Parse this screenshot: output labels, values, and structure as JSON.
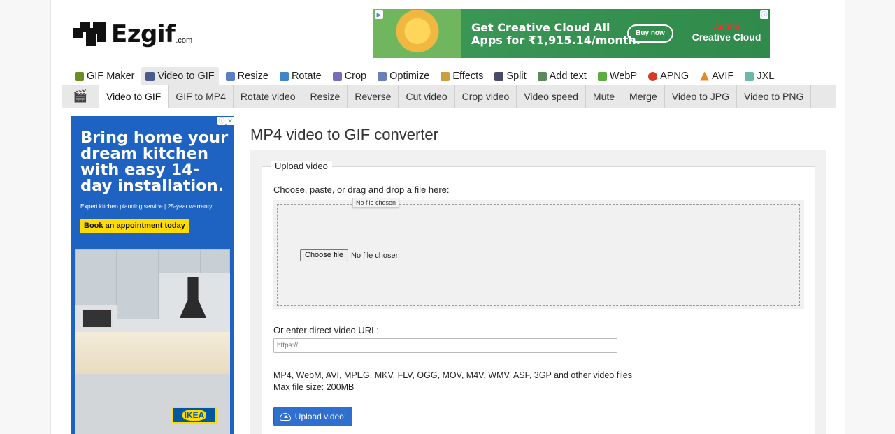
{
  "logo": {
    "name": "Ezgif",
    "suffix": ".com"
  },
  "top_ad": {
    "line1": "Get Creative Cloud All",
    "line2": "Apps for ₹1,915.14/month.",
    "button": "Buy now",
    "brand_line1": "Adobe",
    "brand_line2": "Creative Cloud"
  },
  "main_nav": [
    {
      "label": "GIF Maker",
      "icon": "gif-maker-icon",
      "color": "#6b8e23"
    },
    {
      "label": "Video to GIF",
      "icon": "video-to-gif-icon",
      "color": "#4a5a8a",
      "active": true
    },
    {
      "label": "Resize",
      "icon": "resize-icon",
      "color": "#5b7fc4"
    },
    {
      "label": "Rotate",
      "icon": "rotate-icon",
      "color": "#3f86c9"
    },
    {
      "label": "Crop",
      "icon": "crop-icon",
      "color": "#7a6ab8"
    },
    {
      "label": "Optimize",
      "icon": "optimize-icon",
      "color": "#6a7fb8"
    },
    {
      "label": "Effects",
      "icon": "effects-icon",
      "color": "#c9a03f"
    },
    {
      "label": "Split",
      "icon": "split-icon",
      "color": "#4a4a6a"
    },
    {
      "label": "Add text",
      "icon": "add-text-icon",
      "color": "#5a8a5a"
    },
    {
      "label": "WebP",
      "icon": "webp-icon",
      "color": "#5aad3f"
    },
    {
      "label": "APNG",
      "icon": "apng-icon",
      "color": "#d83a2a"
    },
    {
      "label": "AVIF",
      "icon": "avif-icon",
      "color": "#e08a2a"
    },
    {
      "label": "JXL",
      "icon": "jxl-icon",
      "color": "#6ab8a8"
    }
  ],
  "sub_nav": [
    {
      "label": "Video to GIF",
      "active": true
    },
    {
      "label": "GIF to MP4"
    },
    {
      "label": "Rotate video"
    },
    {
      "label": "Resize"
    },
    {
      "label": "Reverse"
    },
    {
      "label": "Cut video"
    },
    {
      "label": "Crop video"
    },
    {
      "label": "Video speed"
    },
    {
      "label": "Mute"
    },
    {
      "label": "Merge"
    },
    {
      "label": "Video to JPG"
    },
    {
      "label": "Video to PNG"
    }
  ],
  "side_ad": {
    "headline": "Bring home your dream kitchen with easy 14-day installation.",
    "subtext": "Expert kitchen planning service | 25-year warranty",
    "cta": "Book an appointment today",
    "brand": "IKEA"
  },
  "main": {
    "title": "MP4 video to GIF converter",
    "legend": "Upload video",
    "choose_label": "Choose, paste, or drag and drop a file here:",
    "tooltip": "No file chosen",
    "file_button": "Choose file",
    "file_status": "No file chosen",
    "url_label": "Or enter direct video URL:",
    "url_placeholder": "https://",
    "formats": "MP4, WebM, AVI, MPEG, MKV, FLV, OGG, MOV, M4V, WMV, ASF, 3GP and other video files",
    "max_size": "Max file size: 200MB",
    "upload_button": "Upload video!"
  }
}
